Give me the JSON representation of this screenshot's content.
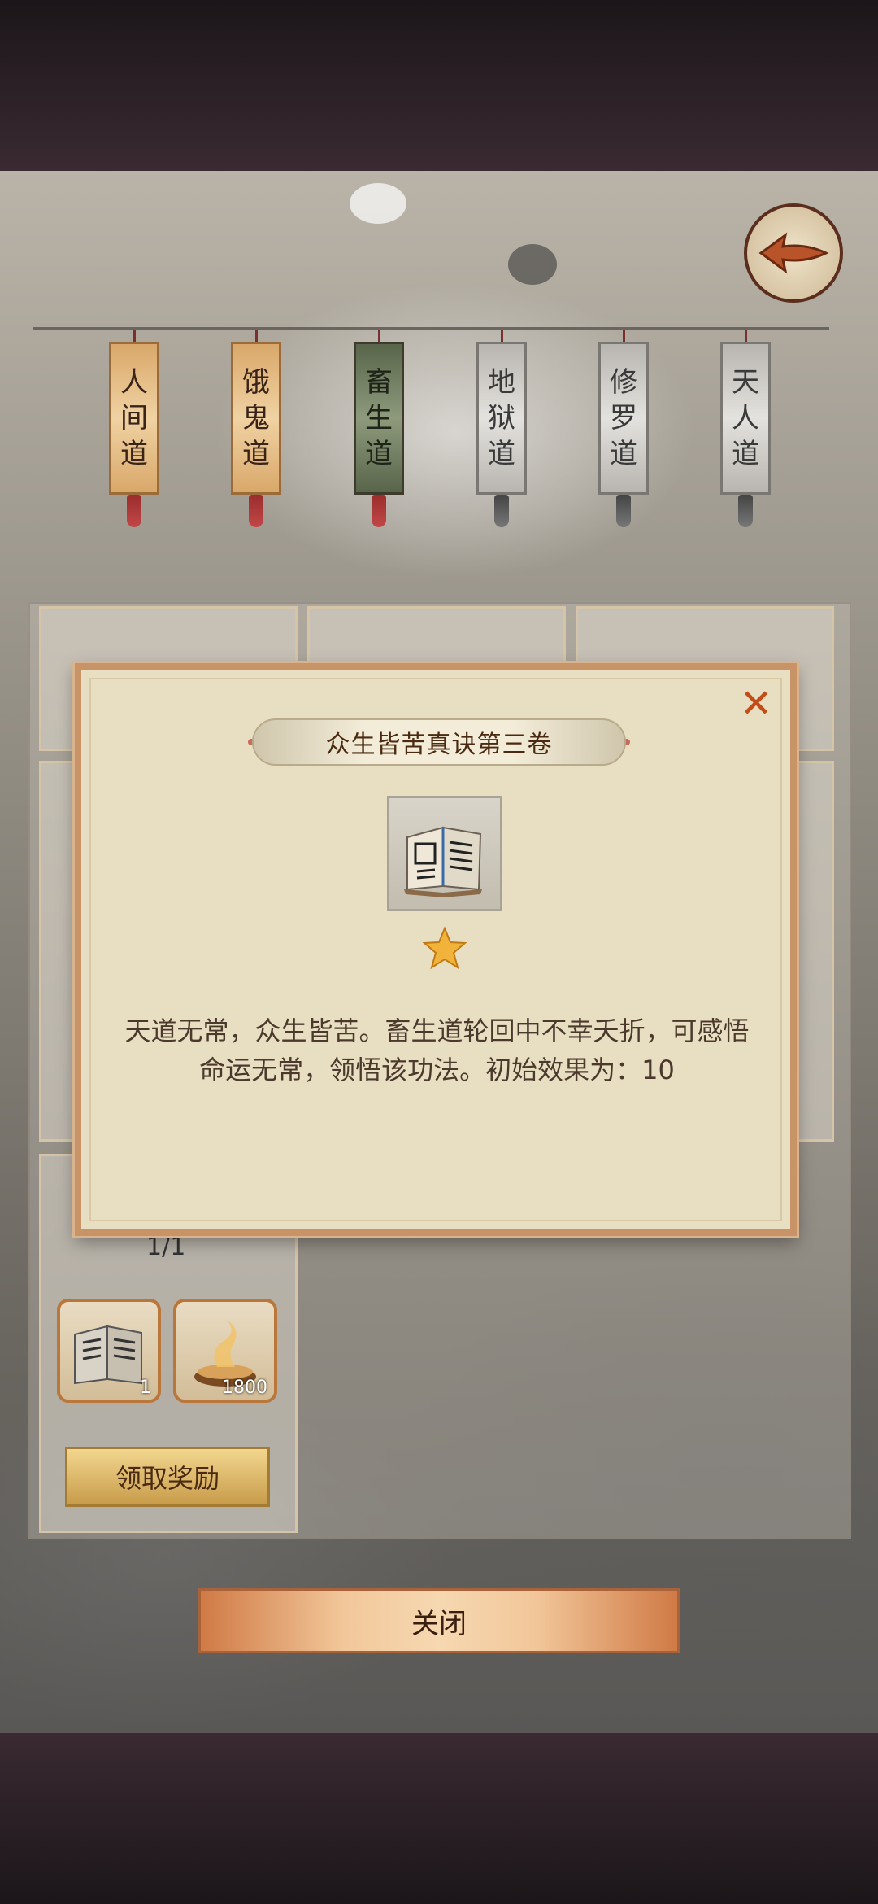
{
  "realm_tabs": [
    {
      "label": "人间道",
      "chars": [
        "人",
        "间",
        "道"
      ],
      "state": "available"
    },
    {
      "label": "饿鬼道",
      "chars": [
        "饿",
        "鬼",
        "道"
      ],
      "state": "available"
    },
    {
      "label": "畜生道",
      "chars": [
        "畜",
        "生",
        "道"
      ],
      "state": "selected"
    },
    {
      "label": "地狱道",
      "chars": [
        "地",
        "狱",
        "道"
      ],
      "state": "locked"
    },
    {
      "label": "修罗道",
      "chars": [
        "修",
        "罗",
        "道"
      ],
      "state": "locked"
    },
    {
      "label": "天人道",
      "chars": [
        "天",
        "人",
        "道"
      ],
      "state": "locked"
    }
  ],
  "quest_card": {
    "progress": "1/1",
    "rewards": [
      {
        "icon": "book-icon",
        "qty": "1"
      },
      {
        "icon": "incense-icon",
        "qty": "1800"
      }
    ],
    "claim_label": "领取奖励"
  },
  "close_button_label": "关闭",
  "dialog": {
    "title": "众生皆苦真诀第三卷",
    "close_icon": "close-icon",
    "item_icon": "book-icon",
    "stars": 1,
    "description": "天道无常，众生皆苦。畜生道轮回中不幸夭折，可感悟命运无常，领悟该功法。初始效果为：10"
  },
  "colors": {
    "accent": "#c89367",
    "close_x": "#c24d18",
    "star": "#f2b33a"
  }
}
